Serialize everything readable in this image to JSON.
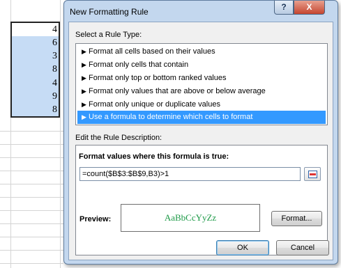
{
  "sheet": {
    "values": [
      "4",
      "6",
      "3",
      "8",
      "4",
      "9",
      "8"
    ]
  },
  "dialog": {
    "title": "New Formatting Rule",
    "help_label": "?",
    "close_label": "X",
    "rule_type_label": "Select a Rule Type:",
    "rule_types": [
      "Format all cells based on their values",
      "Format only cells that contain",
      "Format only top or bottom ranked values",
      "Format only values that are above or below average",
      "Format only unique or duplicate values",
      "Use a formula to determine which cells to format"
    ],
    "selected_rule_index": 5,
    "edit_label": "Edit the Rule Description:",
    "formula_label": "Format values where this formula is true:",
    "formula_value": "=count($B$3:$B$9,B3)>1",
    "preview_label": "Preview:",
    "preview_text": "AaBbCcYyZz",
    "format_button": "Format...",
    "ok_button": "OK",
    "cancel_button": "Cancel"
  },
  "colors": {
    "selection_fill": "#c6dcf5",
    "list_selected": "#3399ff",
    "preview_text": "#1d9a47",
    "dialog_frame": "#c3d7ee"
  },
  "icons": {
    "list_arrow": "triangle-right-icon",
    "collapse_ref": "collapse-dialog-icon"
  }
}
